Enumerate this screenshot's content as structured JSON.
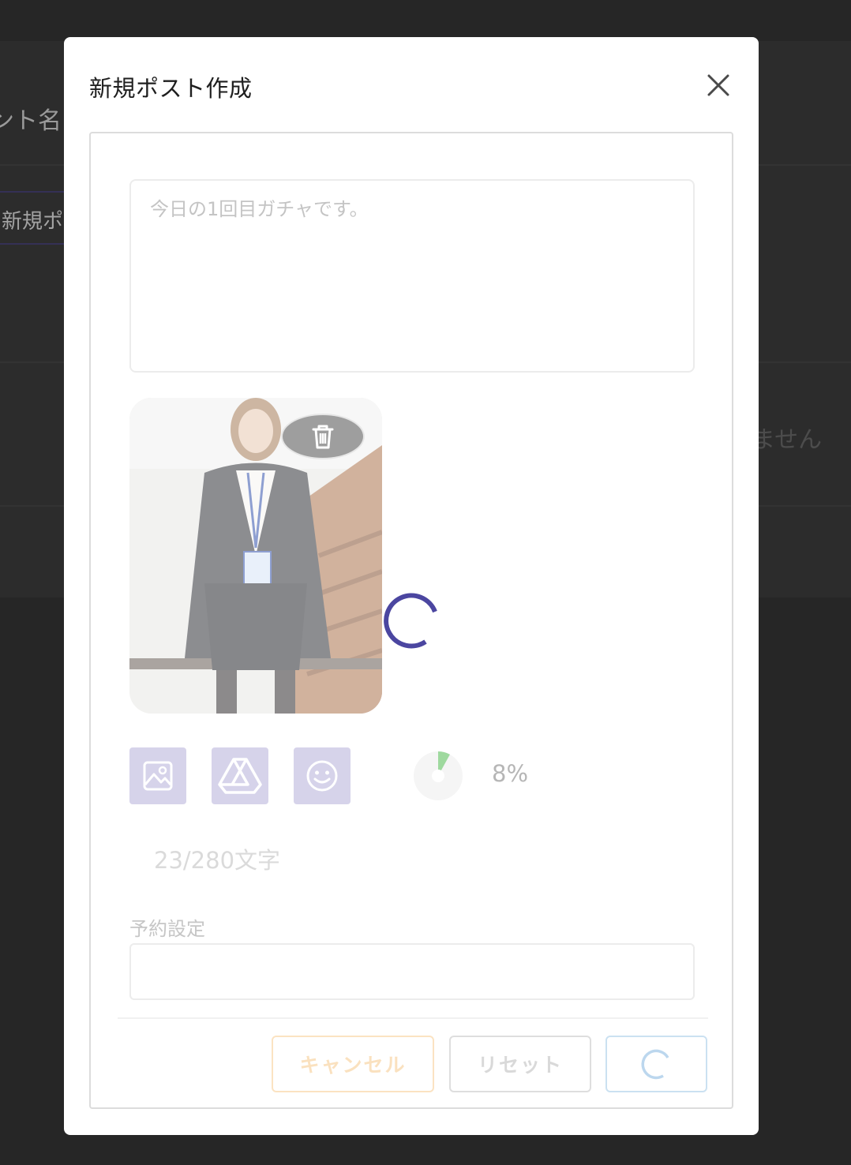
{
  "background": {
    "heading_fragment": "ント名",
    "button_fragment": "新規ポス",
    "empty_fragment": "ません"
  },
  "modal": {
    "title": "新規ポスト作成",
    "close_icon": "close-icon"
  },
  "form": {
    "text_placeholder": "今日の1回目ガチャです。",
    "text_value": "",
    "image": {
      "delete_icon": "trash-icon",
      "status": "loading"
    },
    "toolbar": [
      {
        "icon": "image-icon"
      },
      {
        "icon": "google-drive-icon"
      },
      {
        "icon": "emoji-icon"
      }
    ],
    "upload_progress": 0.08,
    "upload_progress_label": "8%",
    "char_count": "23/280文字",
    "schedule_label": "予約設定",
    "schedule_value": ""
  },
  "buttons": {
    "cancel": "キャンセル",
    "reset": "リセット",
    "submit_state": "loading"
  },
  "colors": {
    "accent": "#4b46a0",
    "toolbar_bg": "#d6d3ea",
    "progress_fill": "#9ed99e",
    "cancel_border": "#fbe3c2",
    "submit_border": "#cbe1f1"
  }
}
